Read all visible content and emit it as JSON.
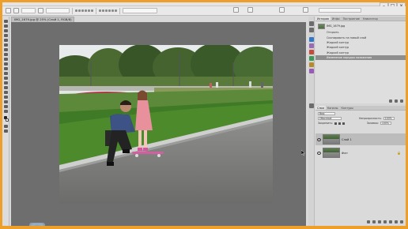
{
  "document": {
    "tab_title": "IMG_1679.jpg @ 25% (Слой 1, RGB/8)"
  },
  "panels": {
    "history": {
      "tabs": [
        "История",
        "Инфо",
        "Построение",
        "Навигатор"
      ],
      "snapshot": "IMG_1679.jpg",
      "steps": [
        "Открыть",
        "Скопировать на новый слой",
        "Жидкий контур",
        "Жидкий контур",
        "Жидкий контур",
        "Изменение порядка наложения"
      ]
    },
    "layers": {
      "tabs": [
        "Слои",
        "Каналы",
        "Контуры"
      ],
      "search_label": "Вид",
      "blend_mode": "Обычные",
      "opacity_label": "Непрозрачность:",
      "opacity": "100%",
      "lock_label": "Закрепить:",
      "fill_label": "Заливка:",
      "fill": "100%",
      "items": [
        {
          "name": "Слой 1",
          "selected": true
        },
        {
          "name": "Фон",
          "selected": false
        }
      ]
    }
  },
  "icons": [
    "move-tool-icon",
    "marquee-icon",
    "lasso-icon",
    "crop-icon",
    "eyedropper-icon",
    "healing-brush-icon",
    "brush-icon",
    "stamp-icon",
    "history-brush-icon",
    "eraser-icon",
    "gradient-icon",
    "blur-icon",
    "dodge-icon",
    "pen-icon",
    "type-icon",
    "path-select-icon",
    "shape-icon",
    "hand-icon",
    "zoom-icon",
    "eye-icon",
    "lock-icon",
    "pointer-cursor-icon"
  ],
  "colors": {
    "frame": "#ee9f2a",
    "canvas_bg": "#6e6e6e",
    "selected_history": "#8e8e8e"
  }
}
